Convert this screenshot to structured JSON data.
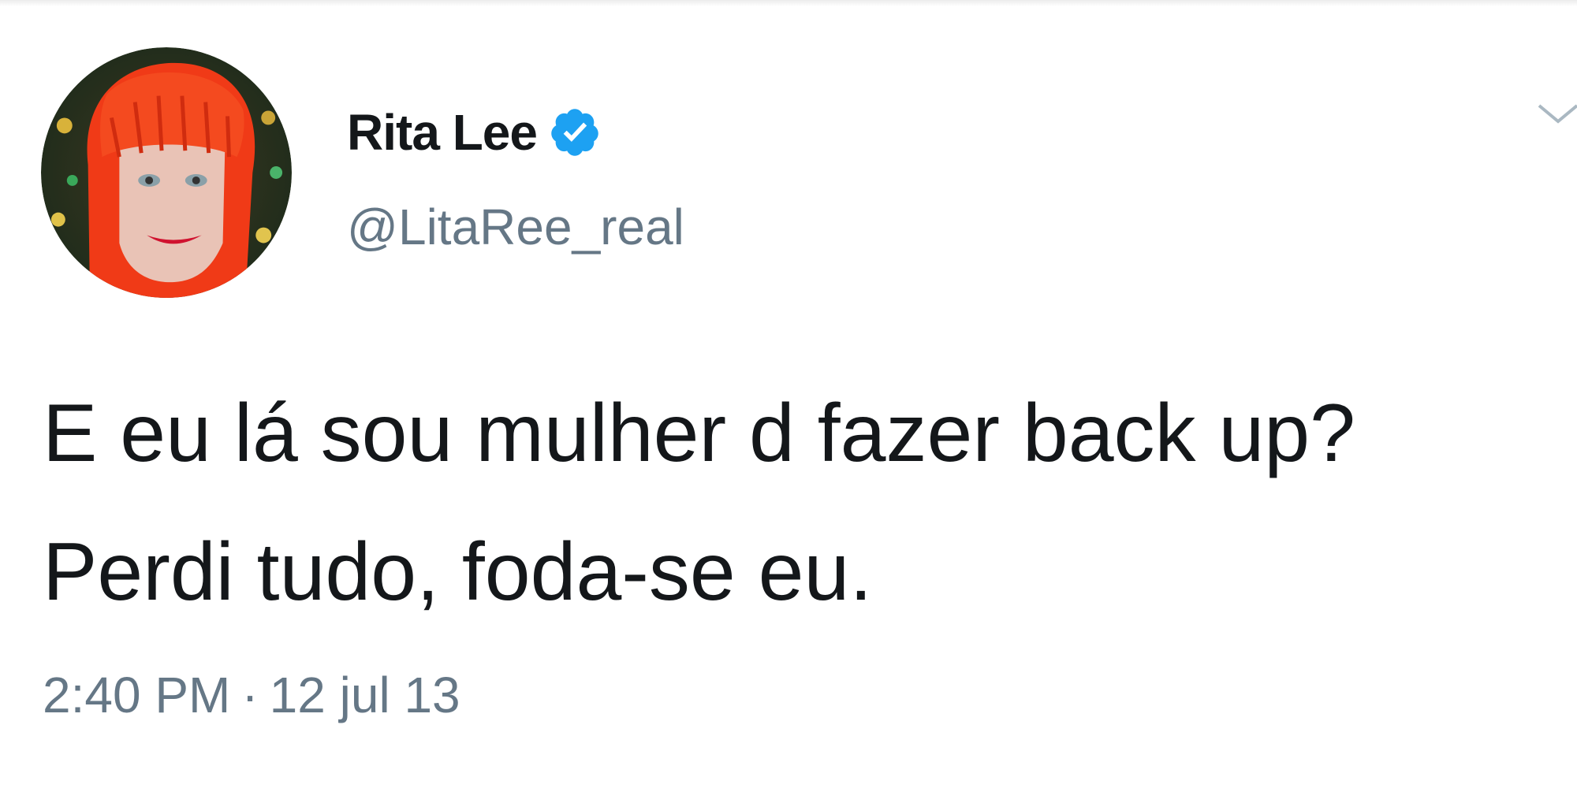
{
  "tweet": {
    "author": {
      "display_name": "Rita Lee",
      "handle": "@LitaRee_real",
      "verified": true,
      "avatar": "profile-photo"
    },
    "text": "E eu lá sou mulher d fazer back up? Perdi tudo, foda-se eu.",
    "time": "2:40 PM",
    "separator": "·",
    "date": "12 jul 13"
  },
  "icons": {
    "verified": "verified-badge-icon",
    "menu": "chevron-down-icon"
  },
  "colors": {
    "verified_blue": "#1da1f2",
    "secondary_text": "#657786",
    "primary_text": "#14171a",
    "avatar_hair": "#f03a17"
  }
}
